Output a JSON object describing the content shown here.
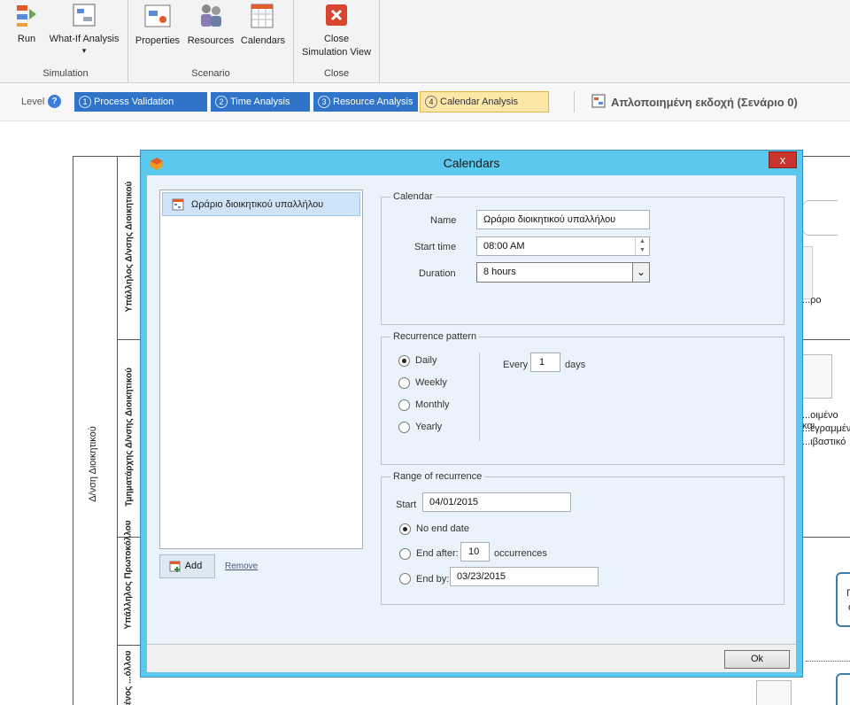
{
  "ribbon": {
    "simulation": {
      "run": "Run",
      "what_if": "What-If Analysis",
      "group": "Simulation"
    },
    "scenario": {
      "properties": "Properties",
      "resources": "Resources",
      "calendars": "Calendars",
      "group": "Scenario"
    },
    "close": {
      "line1": "Close",
      "line2": "Simulation View",
      "group": "Close"
    }
  },
  "levelbar": {
    "label": "Level",
    "help": "?",
    "steps": [
      {
        "num": "1",
        "label": "Process Validation"
      },
      {
        "num": "2",
        "label": "Time Analysis"
      },
      {
        "num": "3",
        "label": "Resource Analysis"
      },
      {
        "num": "4",
        "label": "Calendar Analysis"
      }
    ],
    "view_title": "Απλοποιημένη εκδοχή (Σενάριο 0)"
  },
  "canvas": {
    "pool_label": "Δ/νση Διοικητικού",
    "lanes": [
      "Υπάλληλος Δ/νσης Διοικητικού",
      "Τμηματάρχης Δ/νσης Διοικητικού",
      "Υπάλληλος Πρωτοκόλλου",
      "...μένος ...όλλου"
    ],
    "snippets": [
      "...ρο",
      "...οιμένο και",
      "...εγραμμένο",
      "...ιβαστικό",
      "Π",
      "ό"
    ]
  },
  "dialog": {
    "title": "Calendars",
    "close": "x",
    "list": [
      {
        "label": "Ωράριο διοικητικού υπαλλήλου"
      }
    ],
    "add": "Add",
    "remove": "Remove",
    "calendar": {
      "legend": "Calendar",
      "name_label": "Name",
      "name_value": "Ωράριο διοικητικού υπαλλήλου",
      "start_label": "Start time",
      "start_value": "08:00 AM",
      "duration_label": "Duration",
      "duration_value": "8 hours"
    },
    "recurrence": {
      "legend": "Recurrence pattern",
      "options": [
        "Daily",
        "Weekly",
        "Monthly",
        "Yearly"
      ],
      "every_label": "Every",
      "every_value": "1",
      "days_label": "days"
    },
    "range": {
      "legend": "Range of recurrence",
      "start_label": "Start",
      "start_value": "04/01/2015",
      "no_end": "No end date",
      "end_after": "End after:",
      "occurrences_value": "10",
      "occurrences_label": "occurrences",
      "end_by": "End by:",
      "end_by_value": "03/23/2015"
    },
    "ok": "Ok"
  }
}
